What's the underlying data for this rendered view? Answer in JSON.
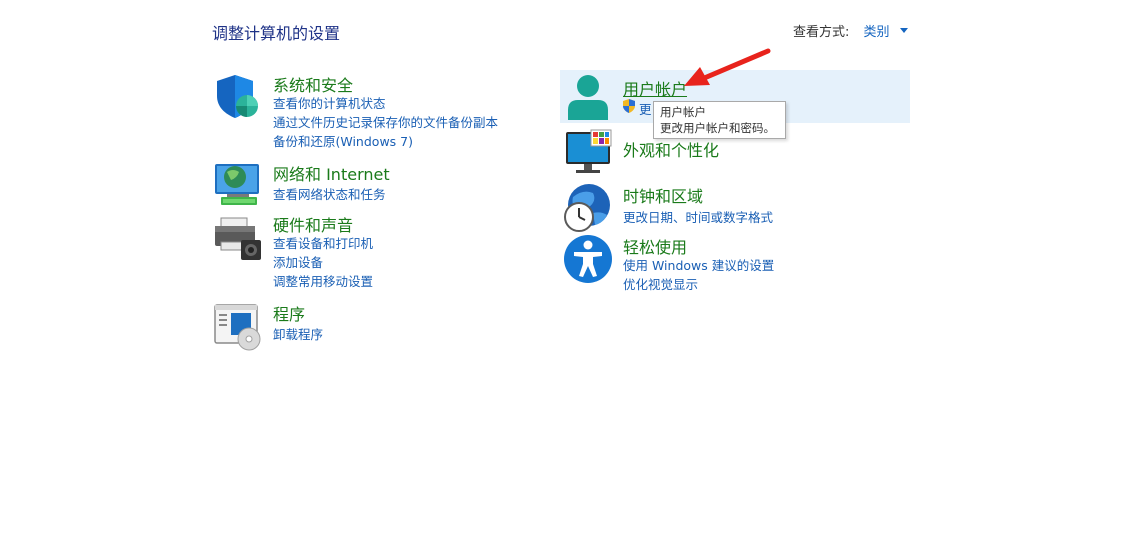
{
  "header": {
    "title": "调整计算机的设置",
    "view_by_label": "查看方式:",
    "view_by_value": "类别"
  },
  "categories": [
    {
      "id": "system-security",
      "title": "系统和安全",
      "icon": "shield-icon",
      "links": [
        "查看你的计算机状态",
        "通过文件历史记录保存你的文件备份副本",
        "备份和还原(Windows 7)"
      ]
    },
    {
      "id": "network-internet",
      "title": "网络和 Internet",
      "icon": "network-globe-icon",
      "links": [
        "查看网络状态和任务"
      ]
    },
    {
      "id": "hardware-sound",
      "title": "硬件和声音",
      "icon": "printer-icon",
      "links": [
        "查看设备和打印机",
        "添加设备",
        "调整常用移动设置"
      ]
    },
    {
      "id": "programs",
      "title": "程序",
      "icon": "programs-icon",
      "links": [
        "卸载程序"
      ]
    },
    {
      "id": "user-accounts",
      "title": "用户帐户",
      "icon": "user-icon",
      "links": [
        "更"
      ]
    },
    {
      "id": "appearance",
      "title": "外观和个性化",
      "icon": "monitor-icon",
      "links": []
    },
    {
      "id": "clock-region",
      "title": "时钟和区域",
      "icon": "clock-globe-icon",
      "links": [
        "更改日期、时间或数字格式"
      ]
    },
    {
      "id": "ease-of-access",
      "title": "轻松使用",
      "icon": "accessibility-icon",
      "links": [
        "使用 Windows 建议的设置",
        "优化视觉显示"
      ]
    }
  ],
  "tooltip": {
    "line1": "用户帐户",
    "line2": "更改用户帐户和密码。"
  },
  "colors": {
    "category_title": "#1a7a1a",
    "link": "#1a5fb4",
    "page_title": "#1e3287",
    "hover_bg": "#e5f1fb",
    "annotation_arrow": "#e8231c"
  }
}
